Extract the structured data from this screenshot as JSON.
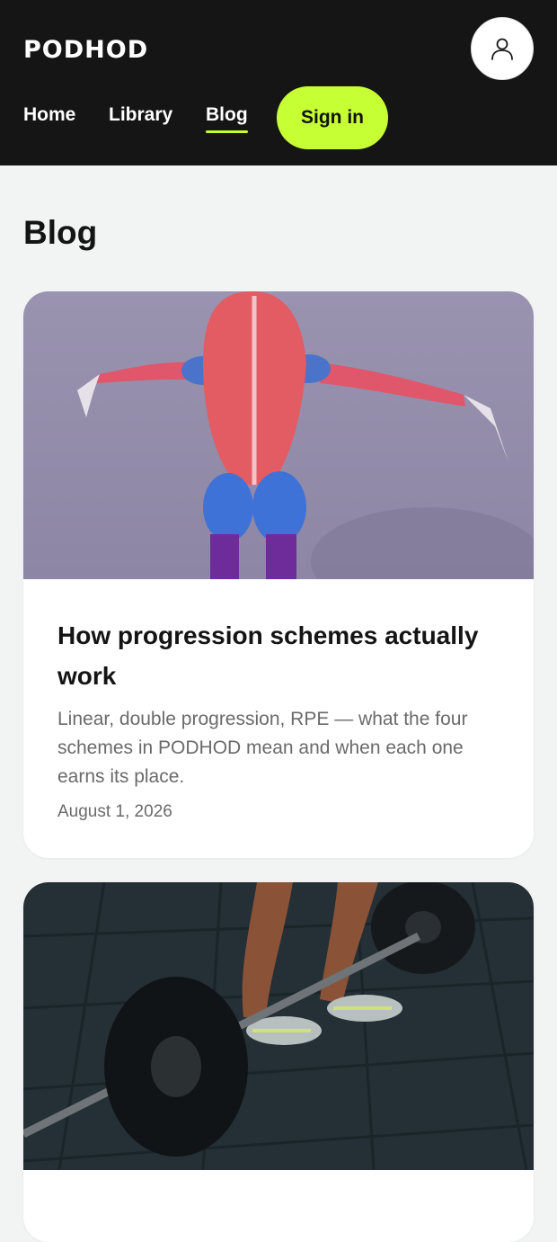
{
  "header": {
    "logo": "PODHOD",
    "nav": {
      "home": "Home",
      "library": "Library",
      "blog": "Blog",
      "sign_in": "Sign in"
    },
    "icons": {
      "profile": "user-icon"
    },
    "colors": {
      "accent": "#c6ff34",
      "background": "#151515"
    }
  },
  "main": {
    "page_title": "Blog",
    "posts": [
      {
        "image": "muscle-anatomy-image",
        "title": "How progression schemes actually work",
        "excerpt": "Linear, double progression, RPE — what the four schemes in PODHOD mean and when each one earns its place.",
        "date": "August 1, 2026"
      },
      {
        "image": "barbell-deadlift-image"
      }
    ]
  }
}
